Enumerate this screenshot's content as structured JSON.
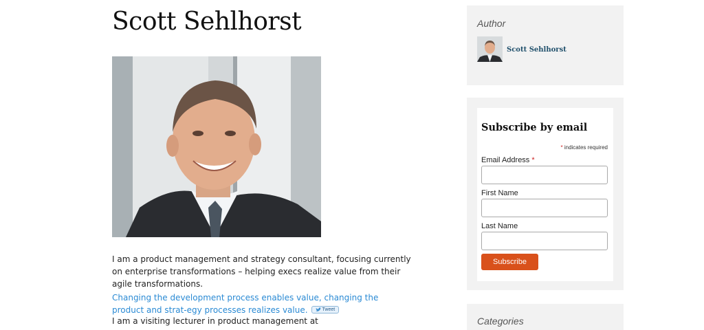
{
  "page": {
    "title": "Scott Sehlhorst"
  },
  "main": {
    "bio": "I am a product management and strategy consultant, focusing currently on enterprise transformations – helping execs realize value from their agile transformations.",
    "quote": "Changing the development process enables value, changing the product and strat-egy processes realizes value.",
    "tweet_label": "Tweet",
    "lecturer": "I am a visiting lecturer in product management at"
  },
  "sidebar": {
    "author": {
      "title": "Author",
      "name": "Scott Sehlhorst"
    },
    "subscribe": {
      "title": "Subscribe by email",
      "required_star": "*",
      "required_note": "indicates required",
      "email_label": "Email Address",
      "first_name_label": "First Name",
      "last_name_label": "Last Name",
      "email_value": "",
      "first_name_value": "",
      "last_name_value": "",
      "button_label": "Subscribe"
    },
    "categories": {
      "title": "Categories"
    }
  },
  "colors": {
    "link": "#2a8ad4",
    "button": "#d9511b",
    "widget_bg": "#f2f2f2",
    "author_link": "#1f4f6b"
  }
}
